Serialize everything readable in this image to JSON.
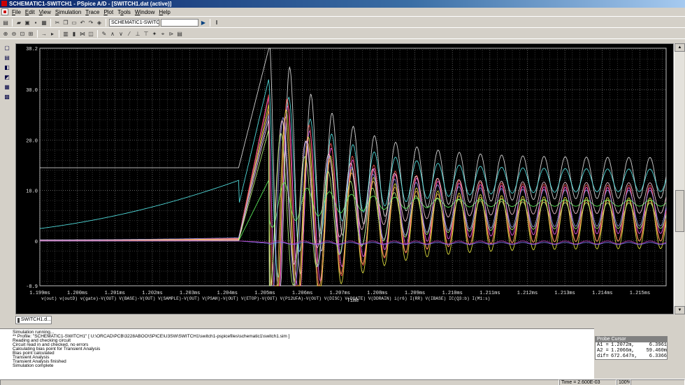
{
  "window": {
    "title": "SCHEMATIC1-SWITCH1 - PSpice A/D - [SWITCH1.dat (active)]"
  },
  "menu": {
    "items": [
      {
        "key": "F",
        "rest": "ile"
      },
      {
        "key": "E",
        "rest": "dit"
      },
      {
        "key": "V",
        "rest": "iew"
      },
      {
        "key": "S",
        "rest": "imulation"
      },
      {
        "key": "T",
        "rest": "race"
      },
      {
        "key": "P",
        "rest": "lot"
      },
      {
        "key": "T",
        "rest": "ools",
        "pre": "T",
        "mid": "o",
        "post": "ols"
      },
      {
        "key": "W",
        "rest": "indow"
      },
      {
        "key": "H",
        "rest": "elp"
      }
    ]
  },
  "toolbar": {
    "profile_value": "SCHEMATIC1-SWITCH1",
    "run_icon": "play-icon",
    "pause_icon": "pause-icon"
  },
  "chart_data": {
    "type": "line",
    "x_axis": {
      "label": "Time",
      "ticks": [
        "1.199ms",
        "1.200ms",
        "1.201ms",
        "1.202ms",
        "1.203ms",
        "1.204ms",
        "1.205ms",
        "1.206ms",
        "1.207ms",
        "1.208ms",
        "1.209ms",
        "1.210ms",
        "1.211ms",
        "1.212ms",
        "1.213ms",
        "1.214ms",
        "1.215ms"
      ],
      "range_ms": [
        1.199,
        1.2157
      ]
    },
    "y_axis": {
      "ticks": [
        "38.2",
        "30.0",
        "20.0",
        "10.0",
        "0",
        "-8.9"
      ],
      "range": [
        -8.9,
        38.2
      ]
    },
    "grid": true,
    "background": "#000000",
    "legend_text": "v(out)  v(outD)  v(gate)-V(OUT)  V(BASE)-V(OUT)  V(SAMPLE)-V(OUT)  V(PSAH)-V(OUT)  V(ETOP)-V(OUT)  V(P12UFA)-V(OUT)  V(DISC)  V(DGATE)  V(DDRAIN)  i(r6)  I(RR)  V(IBASE)  IC(Q3:b)  I(M1:s)",
    "series": [
      {
        "name": "v(out)",
        "color": "#e8e8e8",
        "pre": 14.5,
        "rise": 38.0,
        "osc_center": 12.5,
        "osc_amp": 4.0
      },
      {
        "name": "v(outD)",
        "color": "#58f0f0",
        "pre": 7.0,
        "rise": 32.0,
        "osc_center": 12.0,
        "osc_amp": 2.2
      },
      {
        "name": "v(gate)-V(OUT)",
        "color": "#ff60ff",
        "pre": 0.3,
        "rise": 28.5,
        "osc_center": 6.0,
        "osc_amp": 4.5
      },
      {
        "name": "V(BASE)-V(OUT)",
        "color": "#ff5050",
        "pre": 0.5,
        "rise": 29.0,
        "osc_center": 5.5,
        "osc_amp": 5.5
      },
      {
        "name": "V(SAMPLE)-V(OUT)",
        "color": "#f0f040",
        "pre": 0.2,
        "rise": 27.0,
        "osc_center": 3.5,
        "osc_amp": 5.0
      },
      {
        "name": "V(PSAH)-V(OUT)",
        "color": "#ffb060",
        "pre": 0.4,
        "rise": 26.0,
        "osc_center": 4.0,
        "osc_amp": 4.0
      },
      {
        "name": "V(ETOP)-V(OUT)",
        "color": "#60ff60",
        "pre": 0.0,
        "rise": 12.0,
        "osc_center": 7.5,
        "osc_amp": 0.6
      },
      {
        "name": "V(P12UFA)-V(OUT)",
        "color": "#a0a0ff",
        "pre": 0.6,
        "rise": 25.0,
        "osc_center": 6.5,
        "osc_amp": 3.5
      },
      {
        "name": "V(DISC)",
        "color": "#ffd0e0",
        "pre": 0.1,
        "rise": 24.0,
        "osc_center": 8.5,
        "osc_amp": 3.0
      },
      {
        "name": "V(DGATE)",
        "color": "#c0ff80",
        "pre": 0.0,
        "rise": 22.0,
        "osc_center": 5.0,
        "osc_amp": 2.5
      },
      {
        "name": "V(DDRAIN)",
        "color": "#8080ff",
        "pre": 0.0,
        "rise": -0.5,
        "osc_center": -0.5,
        "osc_amp": 0.2
      },
      {
        "name": "i(r6)",
        "color": "#c040c0",
        "pre": 0.0,
        "rise": -0.3,
        "osc_center": -0.3,
        "osc_amp": 0.3
      }
    ]
  },
  "tabs": {
    "window_tab": "SWITCH1.d..."
  },
  "log": {
    "lines": [
      "Simulation running...",
      "** Profile: \"SCHEMATIC1-SWITCH1\"  [ U:\\ORCAD\\PCB\\3228ABOO\\SPICE\\U3SW\\SWITCH1\\switch1-pspicefiles\\schematic1\\switch1.sim ]",
      "Reading and checking circuit",
      "Circuit read in and checked, no errors",
      "Calculating bias point for Transient Analysis",
      "Bias point calculated",
      "Transient Analysis",
      "Transient Analysis finished",
      "Simulation complete"
    ]
  },
  "probe_cursor": {
    "title": "Probe Cursor",
    "rows": [
      {
        "label": "A1 =",
        "v1": "1.2072m,",
        "v2": "6.3961"
      },
      {
        "label": "A2 =",
        "v1": "1.2066m,",
        "v2": "59.460m"
      },
      {
        "label": "dif=",
        "v1": "672.647n,",
        "v2": "6.3366"
      }
    ]
  },
  "status": {
    "time": "Time = 2.600E-03",
    "percent": "100%"
  }
}
